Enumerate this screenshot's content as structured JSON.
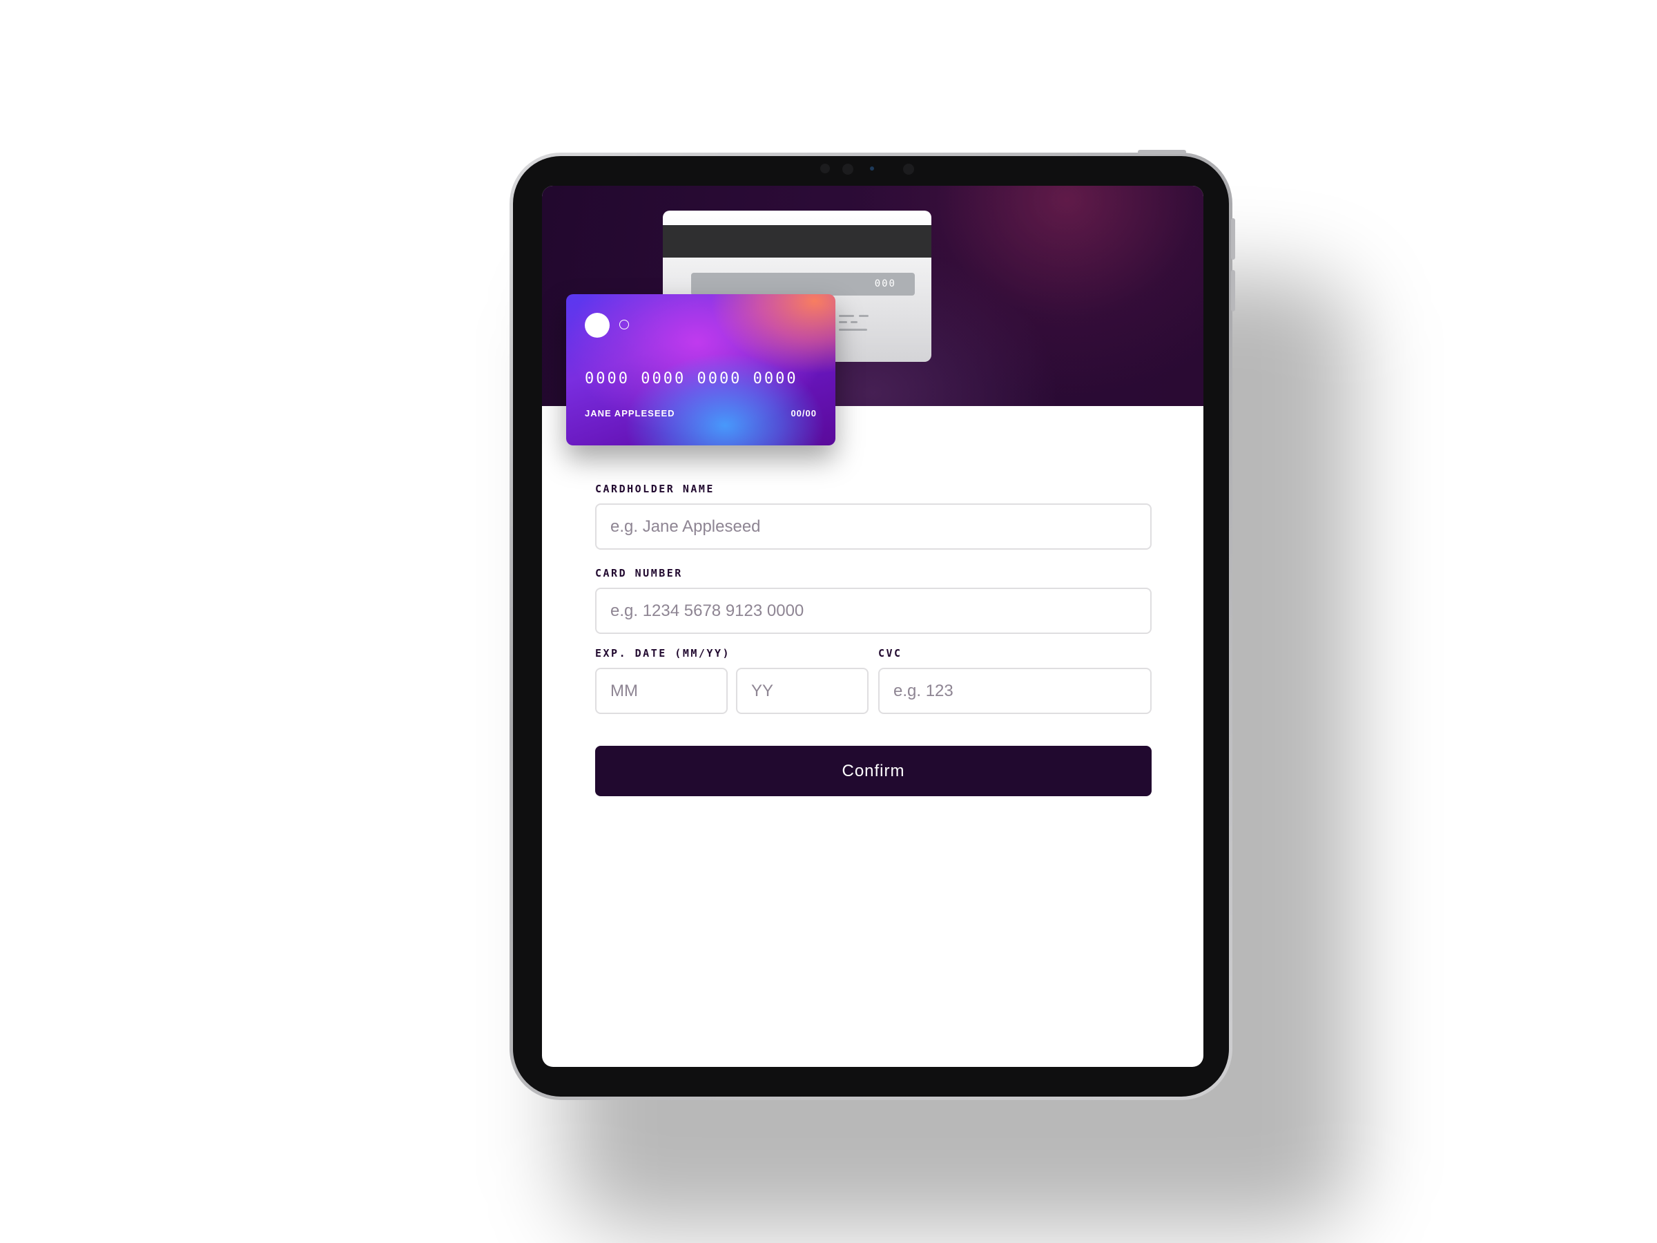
{
  "card_preview": {
    "front": {
      "number": "0000 0000 0000 0000",
      "name": "JANE APPLESEED",
      "expiry": "00/00"
    },
    "back": {
      "cvc": "000"
    }
  },
  "form": {
    "cardholder_name": {
      "label": "CARDHOLDER NAME",
      "placeholder": "e.g. Jane Appleseed",
      "value": ""
    },
    "card_number": {
      "label": "CARD NUMBER",
      "placeholder": "e.g. 1234 5678 9123 0000",
      "value": ""
    },
    "exp_date": {
      "label": "EXP. DATE (MM/YY)",
      "month_placeholder": "MM",
      "year_placeholder": "YY"
    },
    "cvc": {
      "label": "CVC",
      "placeholder": "e.g. 123",
      "value": ""
    },
    "confirm_label": "Confirm"
  },
  "colors": {
    "dark_violet": "#21092f",
    "input_border": "#dfdee0",
    "placeholder": "#8e8593"
  }
}
